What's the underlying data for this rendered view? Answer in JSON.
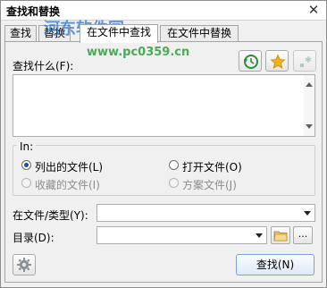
{
  "window": {
    "title": "查找和替换",
    "close_symbol": "✕"
  },
  "watermark": {
    "text_top": "河东软件园",
    "text_bottom": "www.pc0359.cn"
  },
  "tabs": [
    {
      "label": "查找",
      "active": false
    },
    {
      "label": "替换",
      "active": false
    },
    {
      "label": "在文件中查找",
      "active": true
    },
    {
      "label": "在文件中替换",
      "active": false
    }
  ],
  "toolbar": {
    "history_icon": "history-icon",
    "favorite_icon": "star-icon",
    "regex_icon": "regex-icon"
  },
  "find_what": {
    "label": "查找什么(F):",
    "value": ""
  },
  "in_group": {
    "title": "In:",
    "options": [
      {
        "label": "列出的文件(L)",
        "checked": true,
        "disabled": false
      },
      {
        "label": "打开文件(O)",
        "checked": false,
        "disabled": false
      },
      {
        "label": "收藏的文件(I)",
        "checked": false,
        "disabled": true
      },
      {
        "label": "方案文件(J)",
        "checked": false,
        "disabled": true
      }
    ]
  },
  "file_type": {
    "label": "在文件/类型(Y):",
    "value": ""
  },
  "directory": {
    "label": "目录(D):",
    "value": "",
    "browse_label": "...",
    "folder_icon": "folder-icon"
  },
  "footer": {
    "settings_icon": "gear-icon",
    "find_button": "查找(N)"
  },
  "colors": {
    "accent": "#1c4e9c",
    "history_green": "#2e8b3a",
    "star_gold": "#f2b01e",
    "watermark": "#2f78c7"
  }
}
